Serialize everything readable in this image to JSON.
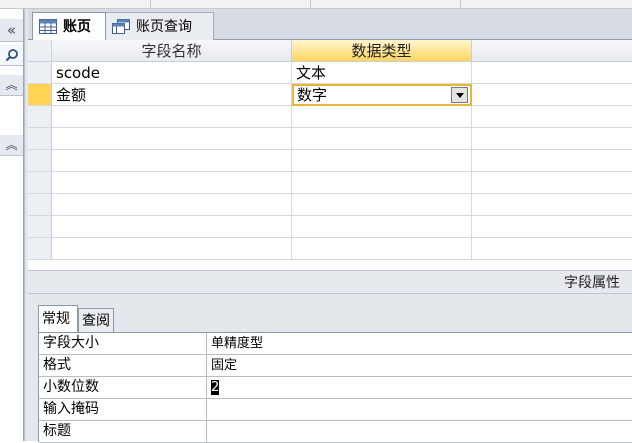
{
  "tabs": {
    "table_tab_label": "账页",
    "query_tab_label": "账页查询"
  },
  "nav_pane": {
    "collapse_glyph": "«",
    "search_glyph": "⚲",
    "group1_glyph": "≈",
    "group2_glyph": "≈"
  },
  "grid": {
    "headers": {
      "field_name": "字段名称",
      "data_type": "数据类型"
    },
    "rows": [
      {
        "field_name": "scode",
        "data_type": "文本"
      },
      {
        "field_name": "金额",
        "data_type": "数字"
      }
    ]
  },
  "properties": {
    "title": "字段属性",
    "tab_general": "常规",
    "tab_lookup": "查阅",
    "rows": [
      {
        "name": "字段大小",
        "value": "单精度型"
      },
      {
        "name": "格式",
        "value": "固定"
      },
      {
        "name": "小数位数",
        "value": "2"
      },
      {
        "name": "输入掩码",
        "value": ""
      },
      {
        "name": "标题",
        "value": ""
      }
    ]
  },
  "colors": {
    "active_header": "#ffd560",
    "active_row_selector": "#ffd455",
    "focus_border": "#e6b53c"
  }
}
